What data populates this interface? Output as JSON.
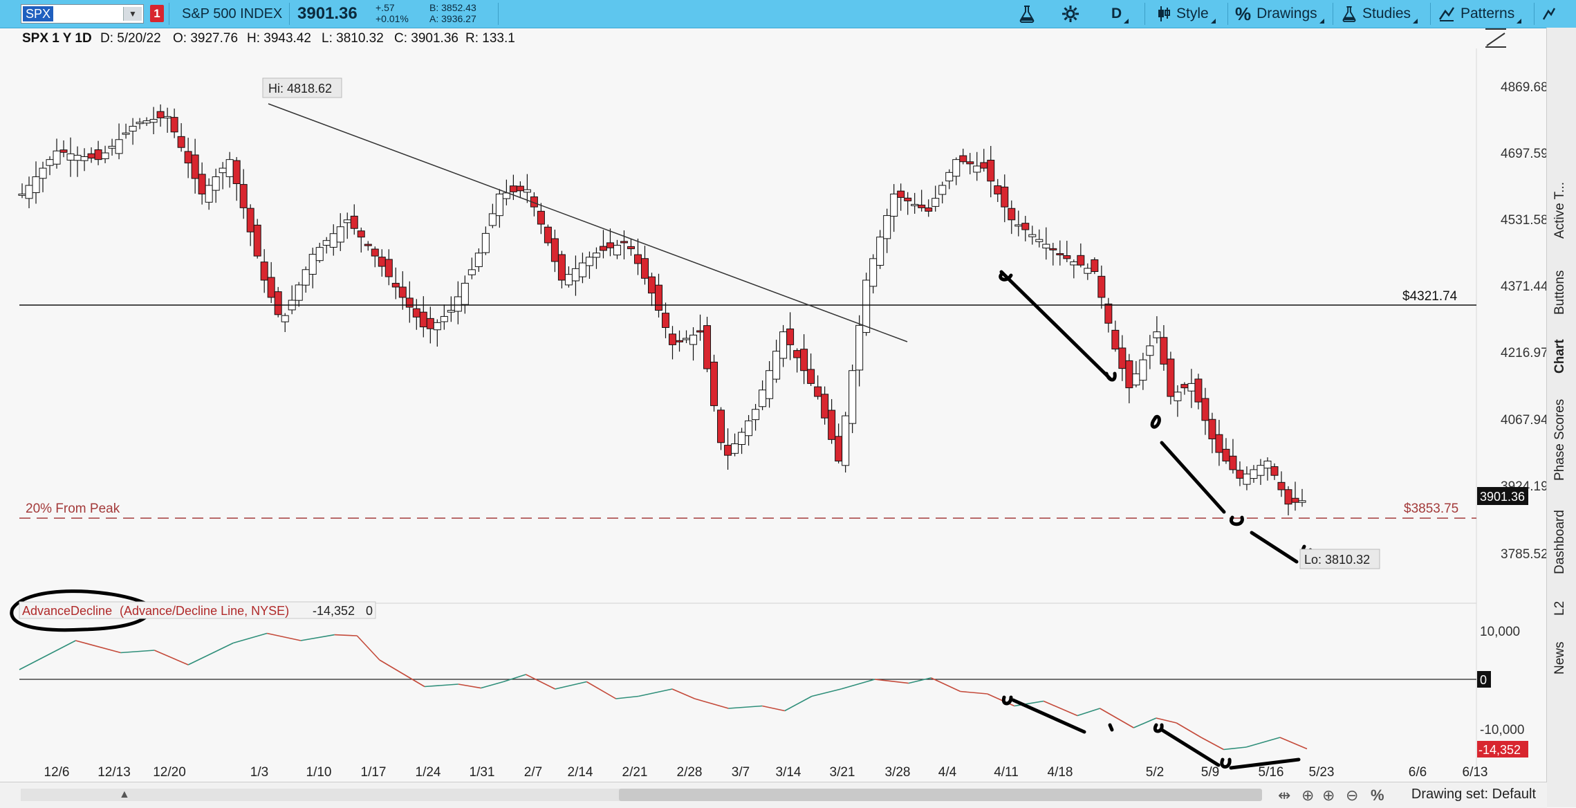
{
  "toolbar": {
    "symbol": "SPX",
    "badge": "1",
    "instrument_name": "S&P 500 INDEX",
    "last_price": "3901.36",
    "change": "+.57",
    "change_pct": "+0.01%",
    "bid": "B: 3852.43",
    "ask": "A: 3936.27",
    "period_btn": "D",
    "style_btn": "Style",
    "drawings_btn": "Drawings",
    "studies_btn": "Studies",
    "patterns_btn": "Patterns",
    "icons": [
      "flask-icon",
      "gear-icon",
      "candlestick-icon",
      "percent-icon",
      "trendline-icon"
    ]
  },
  "infobar": {
    "timeframe": "SPX 1 Y 1D",
    "date": "D: 5/20/22",
    "open": "O: 3927.76",
    "high": "H: 3943.42",
    "low": "L: 3810.32",
    "close": "C: 3901.36",
    "range": "R: 133.1"
  },
  "price_chart": {
    "y_ticks": [
      "4869.68",
      "4697.59",
      "4531.58",
      "4371.44",
      "4216.97",
      "4067.94",
      "3924.19",
      "3785.52"
    ],
    "hi_label": "Hi: 4818.62",
    "lo_label": "Lo: 3810.32",
    "current_price_tag": "3901.36",
    "hline_label": "$4321.74",
    "peak_label": "20% From Peak",
    "peak_value": "$3853.75"
  },
  "study": {
    "name": "AdvanceDecline",
    "params": "(Advance/Decline Line, NYSE)",
    "value": "-14,352",
    "extra": "0",
    "y_ticks": [
      "10,000",
      "0",
      "-10,000"
    ],
    "zero_tag": "0",
    "current_tag": "-14,352"
  },
  "x_axis": [
    "12/6",
    "12/13",
    "12/20",
    "1/3",
    "1/10",
    "1/17",
    "1/24",
    "1/31",
    "2/7",
    "2/14",
    "2/21",
    "2/28",
    "3/7",
    "3/14",
    "3/21",
    "3/28",
    "4/4",
    "4/11",
    "4/18",
    "5/2",
    "5/9",
    "5/16",
    "5/23",
    "6/6",
    "6/13"
  ],
  "side_tabs": [
    "Active T...",
    "Buttons",
    "Chart",
    "Phase Scores",
    "Dashboard",
    "L2",
    "News"
  ],
  "bottom": {
    "drawing_set": "Drawing set: Default"
  },
  "colors": {
    "up": "#ffffff",
    "down": "#d8262f",
    "toolbar": "#5ec6ee",
    "ad_up": "#2f8f7a",
    "ad_down": "#c44a3a"
  }
}
